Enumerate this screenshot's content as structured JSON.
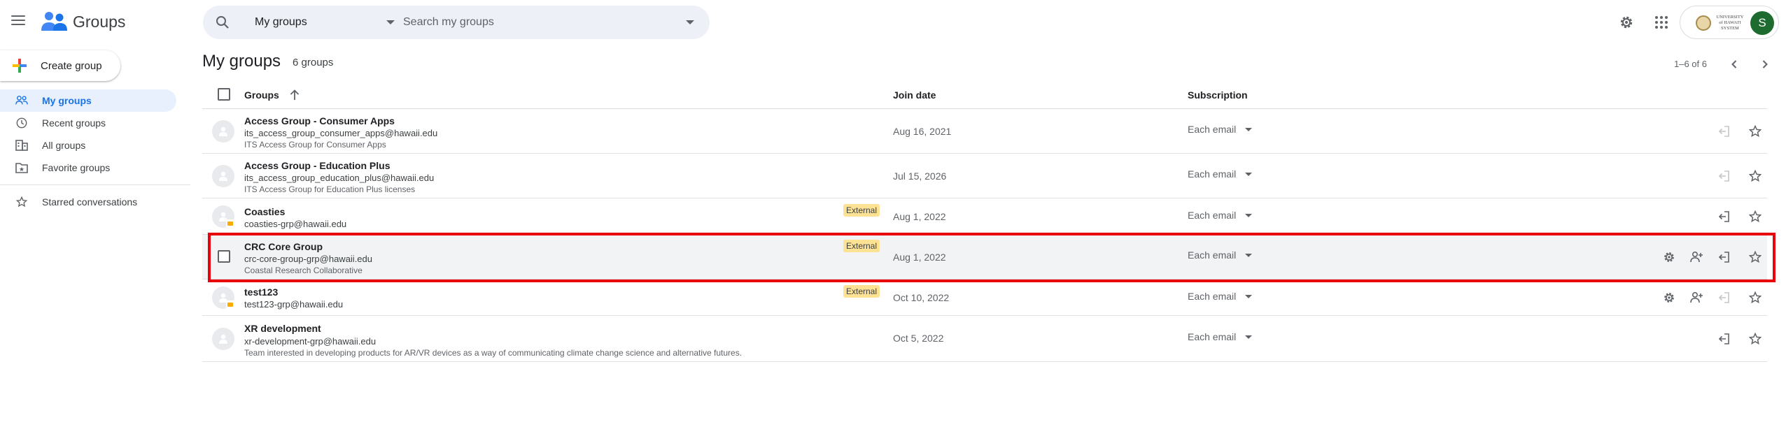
{
  "app": {
    "title": "Groups"
  },
  "search": {
    "scope": "My groups",
    "placeholder": "Search my groups"
  },
  "account": {
    "org_logo_text": "UNIVERSITY of HAWAI'I SYSTEM",
    "avatar_letter": "S",
    "avatar_color": "#1e6b2f"
  },
  "sidebar": {
    "create_label": "Create group",
    "items": [
      {
        "label": "My groups",
        "icon": "people-icon",
        "active": true
      },
      {
        "label": "Recent groups",
        "icon": "clock-icon",
        "active": false
      },
      {
        "label": "All groups",
        "icon": "building-icon",
        "active": false
      },
      {
        "label": "Favorite groups",
        "icon": "folder-star-icon",
        "active": false
      },
      {
        "label": "Starred conversations",
        "icon": "star-icon",
        "active": false
      }
    ]
  },
  "main": {
    "title": "My groups",
    "count": "6 groups",
    "pagination": "1–6 of 6",
    "columns": {
      "groups": "Groups",
      "join_date": "Join date",
      "subscription": "Subscription"
    },
    "rows": [
      {
        "name": "Access Group - Consumer Apps",
        "email": "its_access_group_consumer_apps@hawaii.edu",
        "description": "ITS Access Group for Consumer Apps",
        "external": "",
        "join_date": "Aug 16, 2021",
        "subscription": "Each email"
      },
      {
        "name": "Access Group - Education Plus",
        "email": "its_access_group_education_plus@hawaii.edu",
        "description": "ITS Access Group for Education Plus licenses",
        "external": "",
        "join_date": "Jul 15, 2026",
        "subscription": "Each email"
      },
      {
        "name": "Coasties",
        "email": "coasties-grp@hawaii.edu",
        "description": "",
        "external": "External",
        "join_date": "Aug 1, 2022",
        "subscription": "Each email"
      },
      {
        "name": "CRC Core Group",
        "email": "crc-core-group-grp@hawaii.edu",
        "description": "Coastal Research Collaborative",
        "external": "External",
        "join_date": "Aug 1, 2022",
        "subscription": "Each email"
      },
      {
        "name": "test123",
        "email": "test123-grp@hawaii.edu",
        "description": "",
        "external": "External",
        "join_date": "Oct 10, 2022",
        "subscription": "Each email"
      },
      {
        "name": "XR development",
        "email": "xr-development-grp@hawaii.edu",
        "description": "Team interested in developing products for AR/VR devices as a way of communicating climate change science and alternative futures.",
        "external": "",
        "join_date": "Oct 5, 2022",
        "subscription": "Each email"
      }
    ]
  },
  "colors": {
    "accent": "#1a73e8",
    "highlight": "#e8000b",
    "external_chip": "#fde293",
    "active_nav_bg": "#e8f0fe"
  }
}
